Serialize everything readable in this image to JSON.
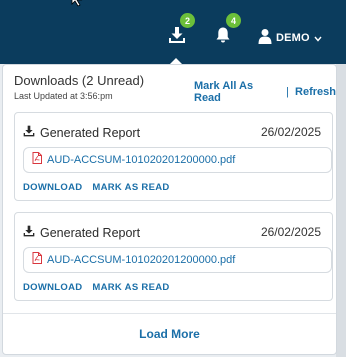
{
  "header": {
    "downloads_badge": "2",
    "notifications_badge": "4",
    "user_label": "DEMO"
  },
  "panel": {
    "title": "Downloads (2 Unread)",
    "subtitle": "Last Updated at 3:56:pm",
    "mark_all_read_label": "Mark All As Read",
    "separator": "|",
    "refresh_label": "Refresh",
    "load_more_label": "Load More"
  },
  "downloads": [
    {
      "title": "Generated Report",
      "date": "26/02/2025",
      "file_name": "AUD-ACCSUM-101020201200000.pdf",
      "download_label": "DOWNLOAD",
      "mark_read_label": "MARK AS READ"
    },
    {
      "title": "Generated Report",
      "date": "26/02/2025",
      "file_name": "AUD-ACCSUM-101020201200000.pdf",
      "download_label": "DOWNLOAD",
      "mark_read_label": "MARK AS READ"
    }
  ],
  "icons": {
    "downloads": "download-icon",
    "notifications": "bell-icon",
    "user": "user-icon",
    "user_menu_caret": "chevron-down-icon",
    "card": "download-icon",
    "file": "pdf-icon"
  },
  "colors": {
    "topbar": "#0b3c5d",
    "badge": "#6cbf3a",
    "link": "#1b6fa8",
    "pdf": "#d9363e"
  }
}
